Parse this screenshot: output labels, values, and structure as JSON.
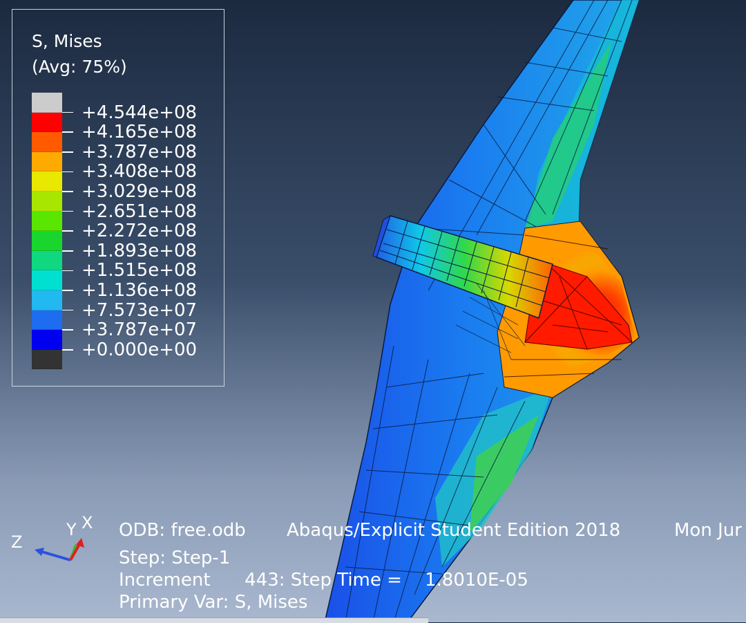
{
  "legend": {
    "title": "S, Mises",
    "avg": "(Avg: 75%)",
    "colors": [
      "#cccccc",
      "#ff0000",
      "#ff5a00",
      "#ffaa00",
      "#e8e800",
      "#a8e600",
      "#5ae600",
      "#18d62e",
      "#10d880",
      "#00e0d0",
      "#22b8f0",
      "#1e6cf0",
      "#0000f0",
      "#333333"
    ],
    "ticks": [
      "+4.544e+08",
      "+4.165e+08",
      "+3.787e+08",
      "+3.408e+08",
      "+3.029e+08",
      "+2.651e+08",
      "+2.272e+08",
      "+1.893e+08",
      "+1.515e+08",
      "+1.136e+08",
      "+7.573e+07",
      "+3.787e+07",
      "+0.000e+00"
    ]
  },
  "info": {
    "odb": "ODB: free.odb",
    "edition": "Abaqus/Explicit Student Edition 2018",
    "date": "Mon Jur",
    "step": "Step: Step-1",
    "increment": "Increment      443: Step Time =    1.8010E-05",
    "primary_var": "Primary Var: S, Mises"
  },
  "triad": {
    "y_label": "Y",
    "x_label": "X",
    "z_label": "Z",
    "colors": {
      "z": "#2a52e0",
      "y": "#30c030",
      "x": "#e02020"
    }
  }
}
